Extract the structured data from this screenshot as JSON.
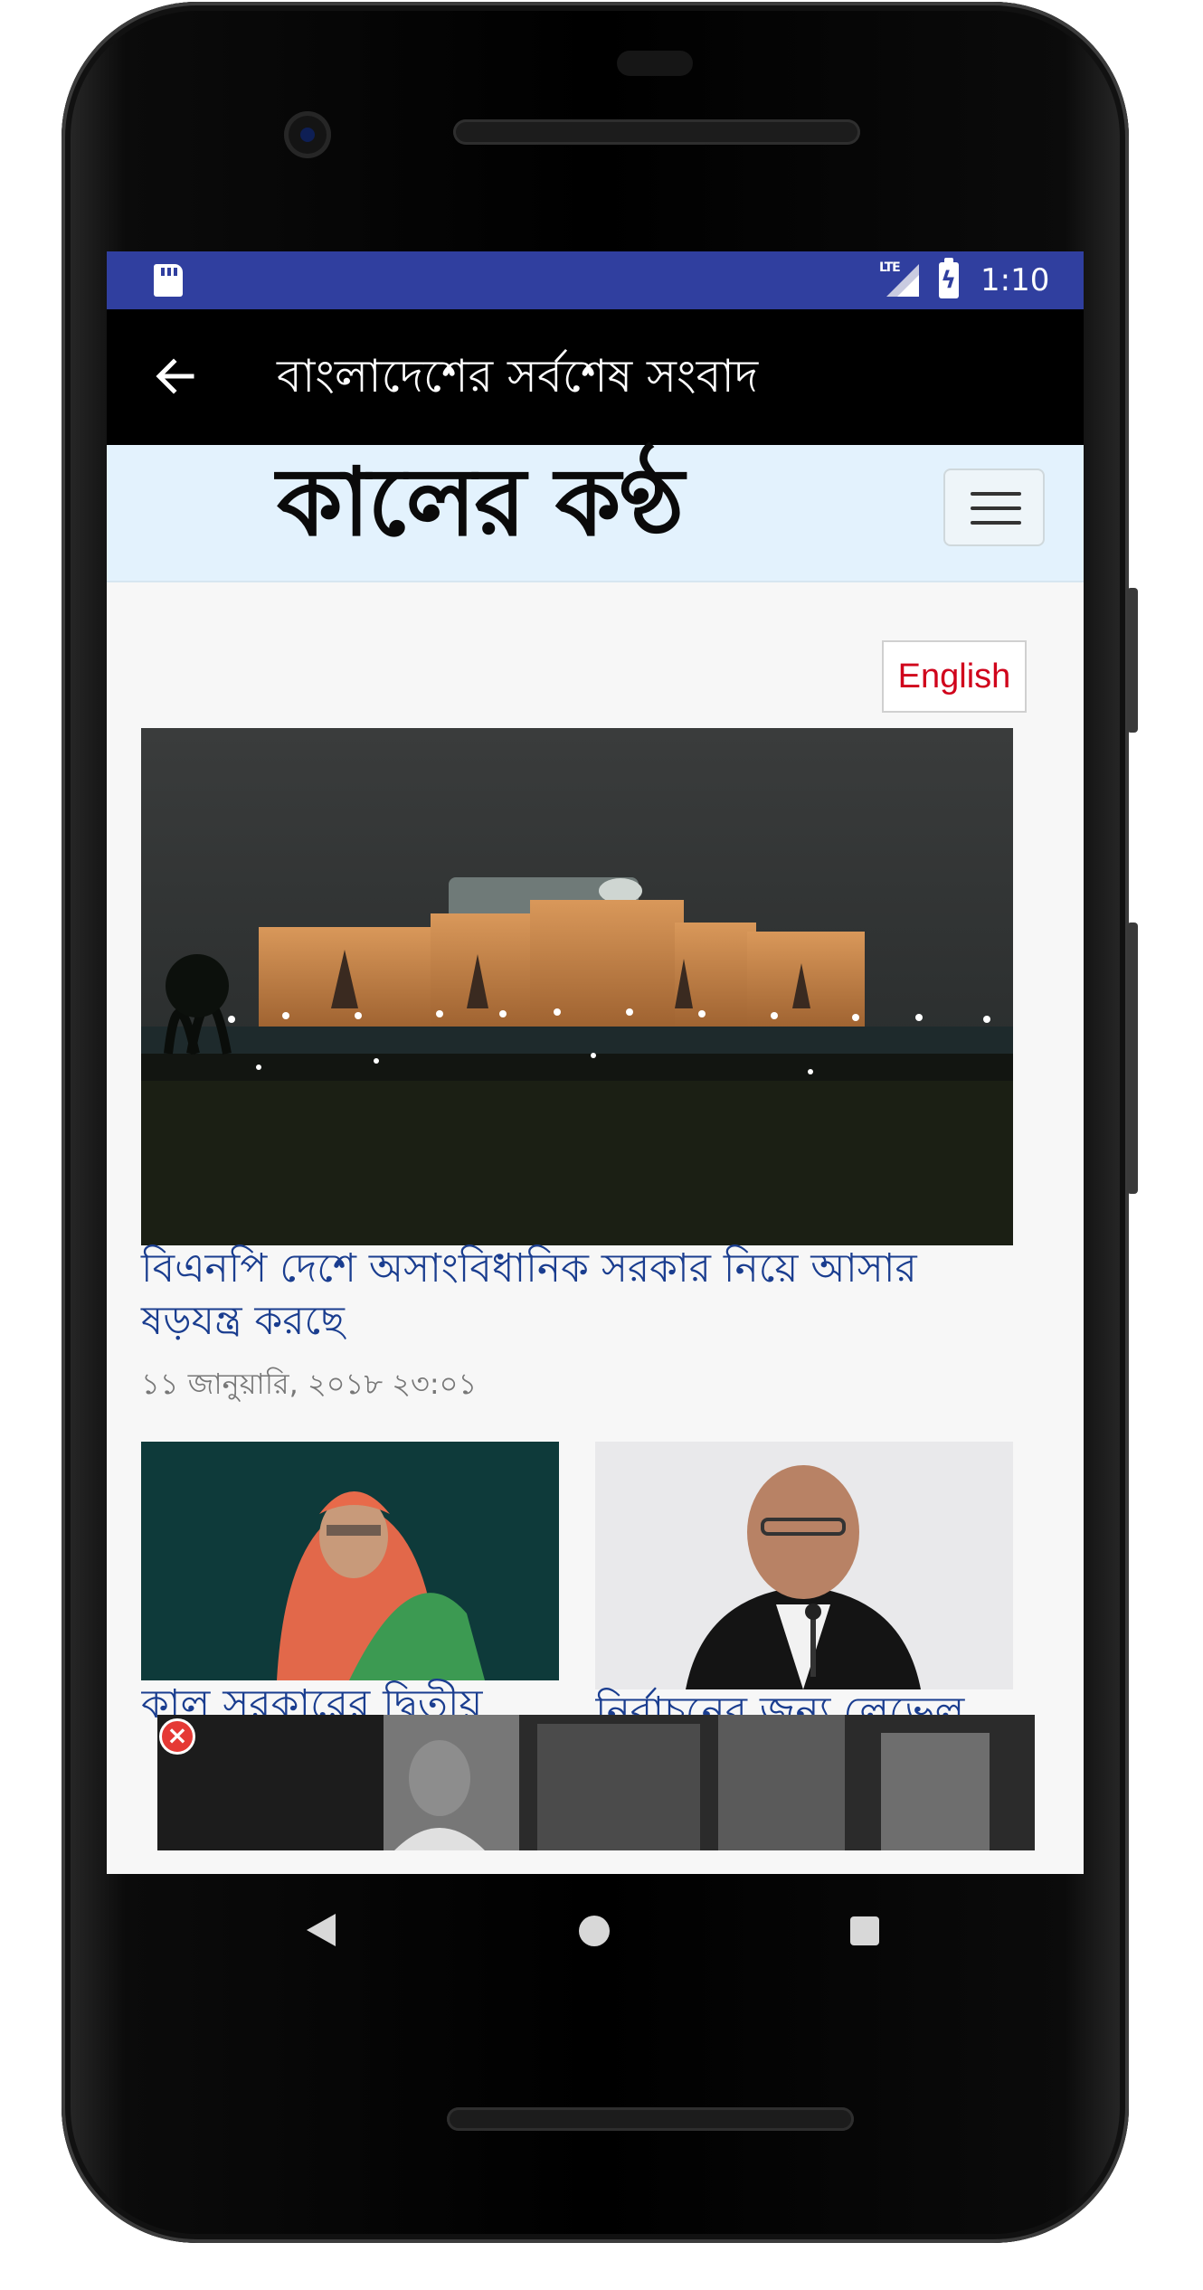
{
  "statusbar": {
    "network": "LTE",
    "time": "1:10"
  },
  "toolbar": {
    "title": "বাংলাদেশের সর্বশেষ সংবাদ"
  },
  "site": {
    "logo_text": "কালের কণ্ঠ",
    "language_button": "English"
  },
  "lead_story": {
    "title": "বিএনপি দেশে অসাংবিধানিক সরকার নিয়ে আসার ষড়যন্ত্র করছে",
    "date": "১১ জানুয়ারি, ২০১৮ ২৩:০১"
  },
  "stories": [
    {
      "title": "কাল সরকারের দ্বিতীয়"
    },
    {
      "title": "নির্বাচনের জন্য লেভেল"
    }
  ],
  "colors": {
    "status_bar": "#303f9f",
    "header_bg": "#e3f2fd",
    "headline": "#1a3d8f",
    "english_button_text": "#d0021b"
  }
}
